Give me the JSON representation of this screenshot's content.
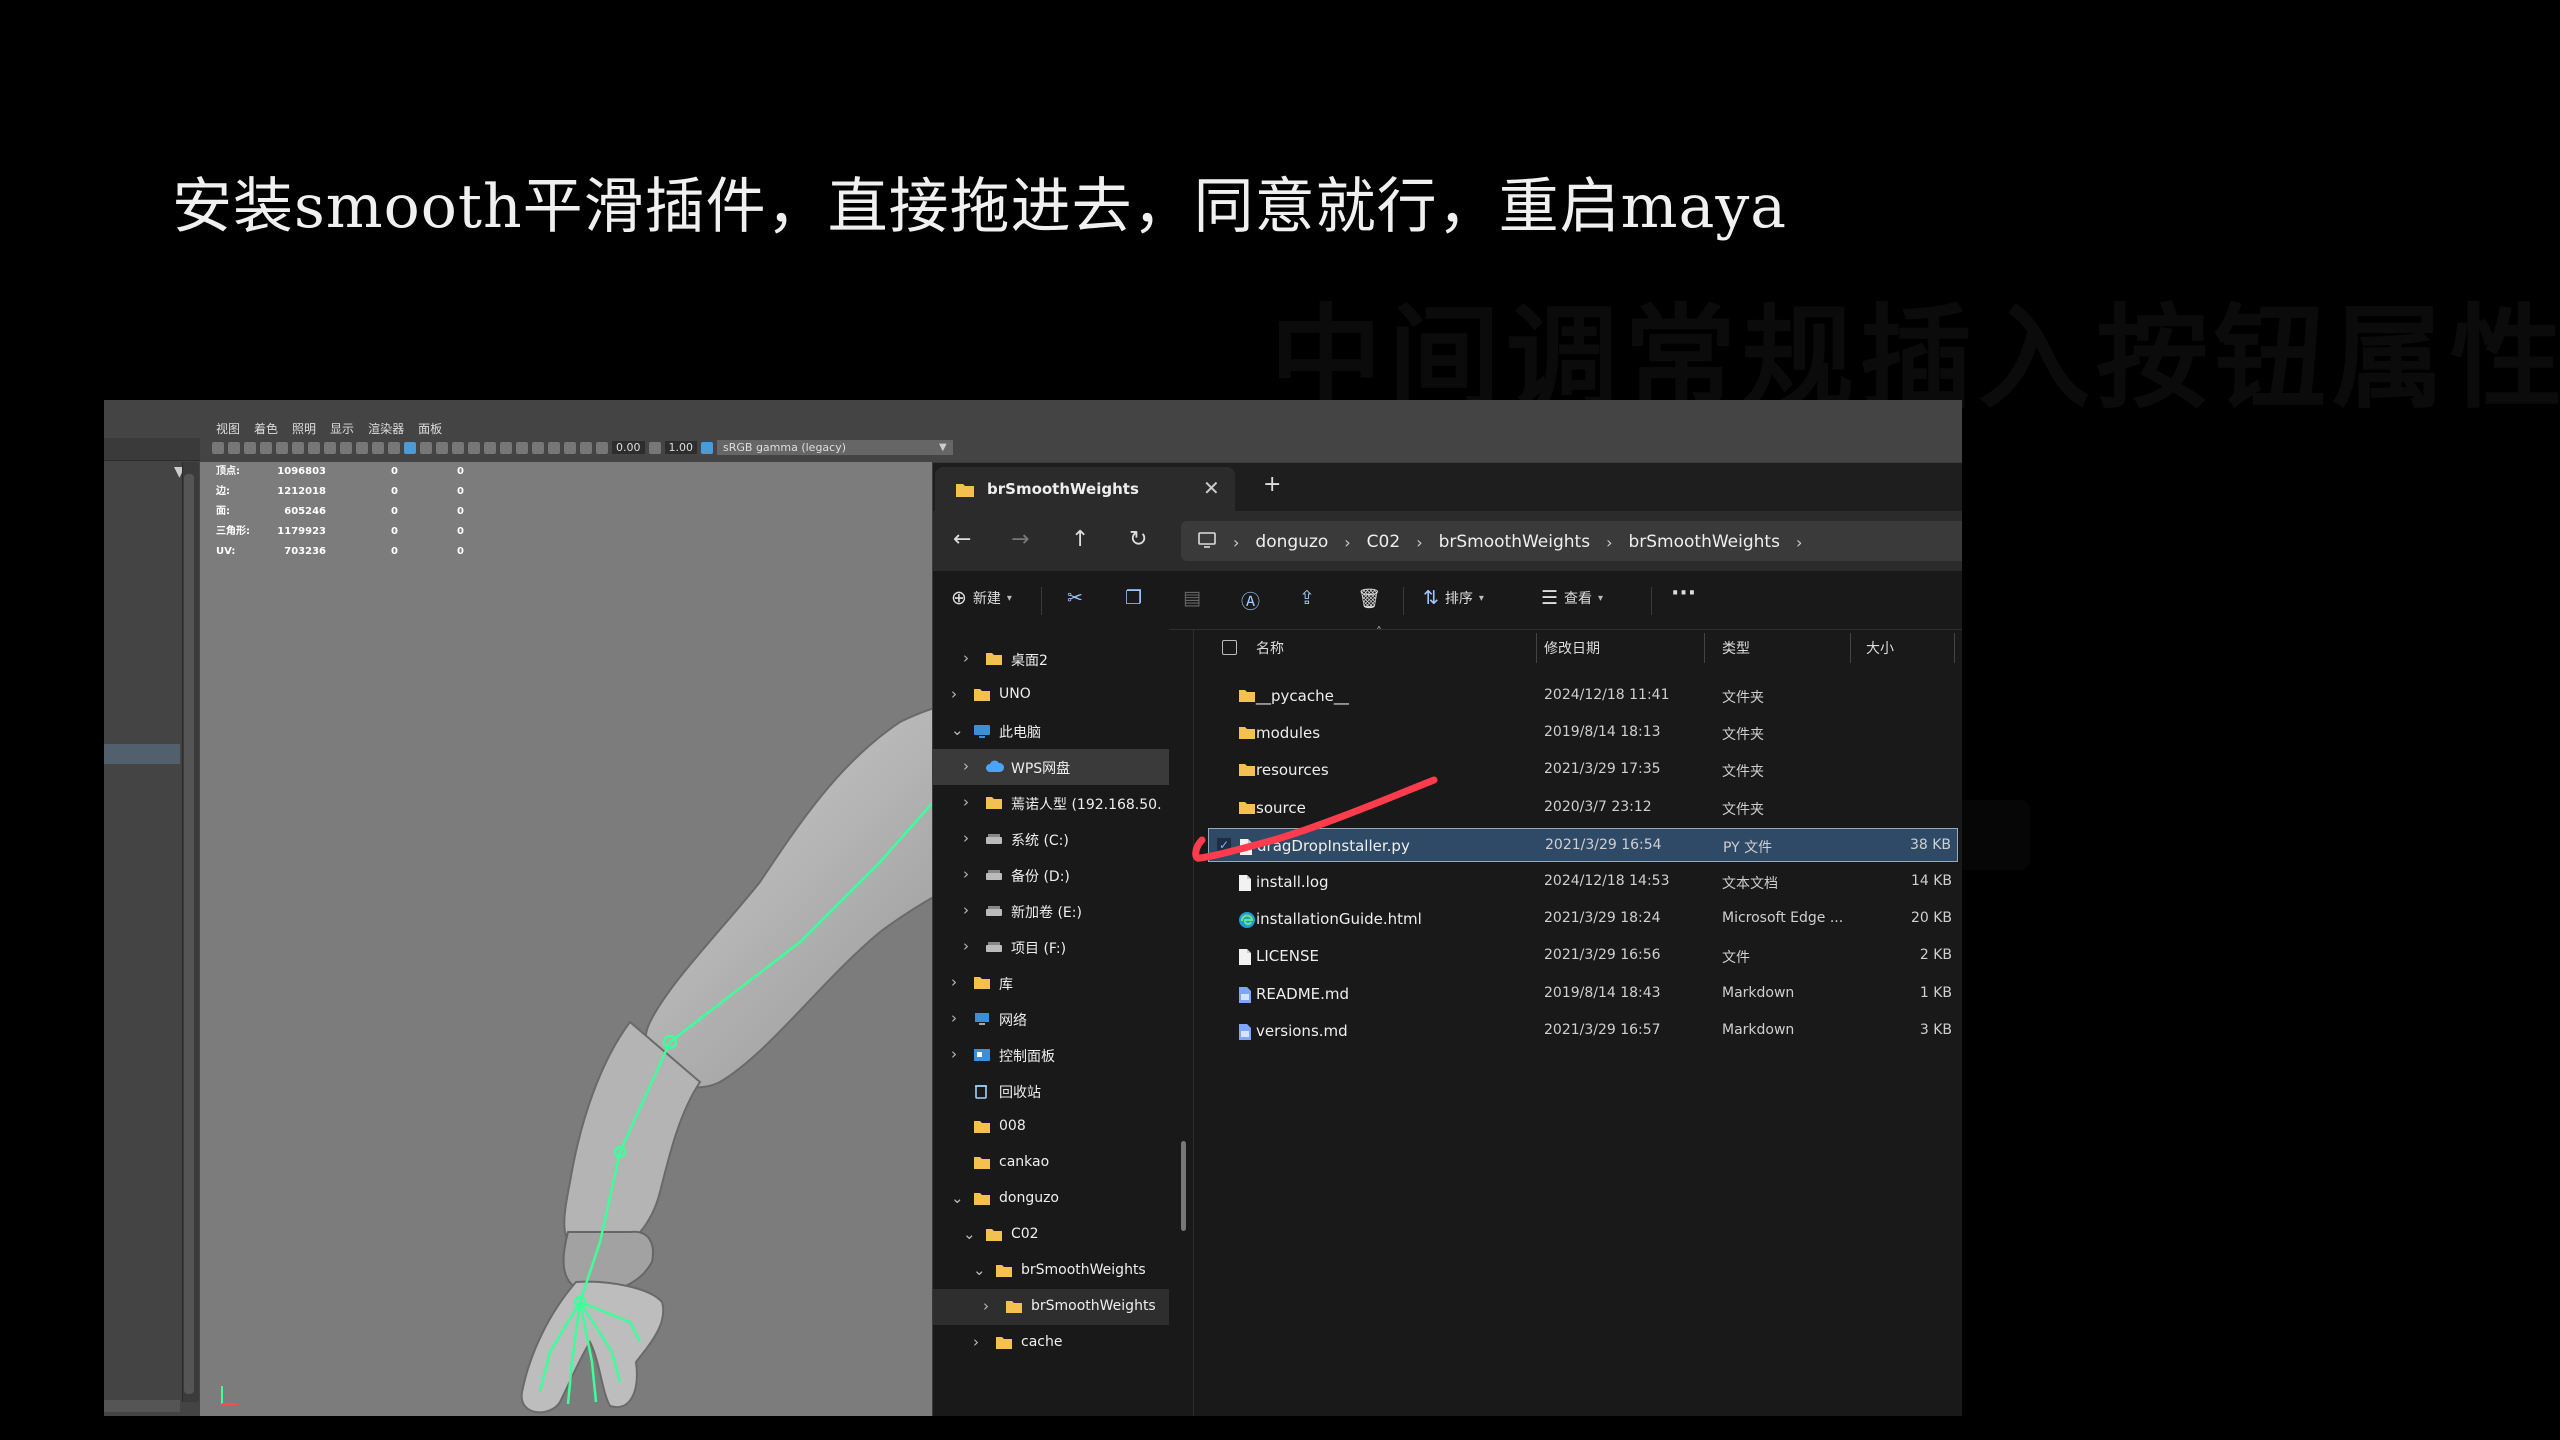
{
  "slide": {
    "title": "安装smooth平滑插件，直接拖进去，同意就行，重启maya",
    "ghost_text": "中间调常规插入按钮属性"
  },
  "maya": {
    "menu": [
      "视图",
      "着色",
      "照明",
      "显示",
      "渲染器",
      "面板"
    ],
    "toolbar": {
      "value_a": "0.00",
      "value_b": "1.00",
      "gamma_label": "sRGB gamma (legacy)"
    },
    "hud": [
      {
        "label": "顶点:",
        "v1": "1096803",
        "v2": "0",
        "v3": "0"
      },
      {
        "label": "边:",
        "v1": "1212018",
        "v2": "0",
        "v3": "0"
      },
      {
        "label": "面:",
        "v1": "605246",
        "v2": "0",
        "v3": "0"
      },
      {
        "label": "三角形:",
        "v1": "1179923",
        "v2": "0",
        "v3": "0"
      },
      {
        "label": "UV:",
        "v1": "703236",
        "v2": "0",
        "v3": "0"
      }
    ]
  },
  "explorer": {
    "tab_title": "brSmoothWeights",
    "breadcrumbs": [
      "donguzo",
      "C02",
      "brSmoothWeights",
      "brSmoothWeights"
    ],
    "commands": {
      "new": "新建",
      "sort": "排序",
      "view": "查看"
    },
    "nav_items": [
      {
        "label": "桌面2",
        "icon": "folder"
      },
      {
        "label": "UNO",
        "icon": "folder"
      },
      {
        "label": "此电脑",
        "icon": "pc"
      },
      {
        "label": "WPS网盘",
        "icon": "cloud"
      },
      {
        "label": "蔫诺人型 (192.168.50.",
        "icon": "folder"
      },
      {
        "label": "系统 (C:)",
        "icon": "drive"
      },
      {
        "label": "备份 (D:)",
        "icon": "drive"
      },
      {
        "label": "新加卷 (E:)",
        "icon": "drive"
      },
      {
        "label": "项目 (F:)",
        "icon": "drive"
      },
      {
        "label": "库",
        "icon": "folder"
      },
      {
        "label": "网络",
        "icon": "network"
      },
      {
        "label": "控制面板",
        "icon": "control"
      },
      {
        "label": "回收站",
        "icon": "trash"
      },
      {
        "label": "008",
        "icon": "folder"
      },
      {
        "label": "cankao",
        "icon": "folder"
      },
      {
        "label": "donguzo",
        "icon": "folder"
      },
      {
        "label": "C02",
        "icon": "folder"
      },
      {
        "label": "brSmoothWeights",
        "icon": "folder"
      },
      {
        "label": "brSmoothWeights",
        "icon": "folder"
      },
      {
        "label": "cache",
        "icon": "folder"
      }
    ],
    "columns": {
      "name": "名称",
      "date": "修改日期",
      "type": "类型",
      "size": "大小"
    },
    "files": [
      {
        "name": "__pycache__",
        "date": "2024/12/18 11:41",
        "type": "文件夹",
        "size": "",
        "icon": "folder"
      },
      {
        "name": "modules",
        "date": "2019/8/14 18:13",
        "type": "文件夹",
        "size": "",
        "icon": "folder"
      },
      {
        "name": "resources",
        "date": "2021/3/29 17:35",
        "type": "文件夹",
        "size": "",
        "icon": "folder"
      },
      {
        "name": "source",
        "date": "2020/3/7 23:12",
        "type": "文件夹",
        "size": "",
        "icon": "folder"
      },
      {
        "name": "dragDropInstaller.py",
        "date": "2021/3/29 16:54",
        "type": "PY 文件",
        "size": "38 KB",
        "icon": "file"
      },
      {
        "name": "install.log",
        "date": "2024/12/18 14:53",
        "type": "文本文档",
        "size": "14 KB",
        "icon": "file"
      },
      {
        "name": "installationGuide.html",
        "date": "2021/3/29 18:24",
        "type": "Microsoft Edge ...",
        "size": "20 KB",
        "icon": "edge"
      },
      {
        "name": "LICENSE",
        "date": "2021/3/29 16:56",
        "type": "文件",
        "size": "2 KB",
        "icon": "file"
      },
      {
        "name": "README.md",
        "date": "2019/8/14 18:43",
        "type": "Markdown",
        "size": "1 KB",
        "icon": "md"
      },
      {
        "name": "versions.md",
        "date": "2021/3/29 16:57",
        "type": "Markdown",
        "size": "3 KB",
        "icon": "md"
      }
    ],
    "selected_file_index": 4
  },
  "colors": {
    "folder": "#f2c14e",
    "selection": "#2f4a66",
    "annotation": "#ff3b4e",
    "rig": "#3dff9a"
  }
}
